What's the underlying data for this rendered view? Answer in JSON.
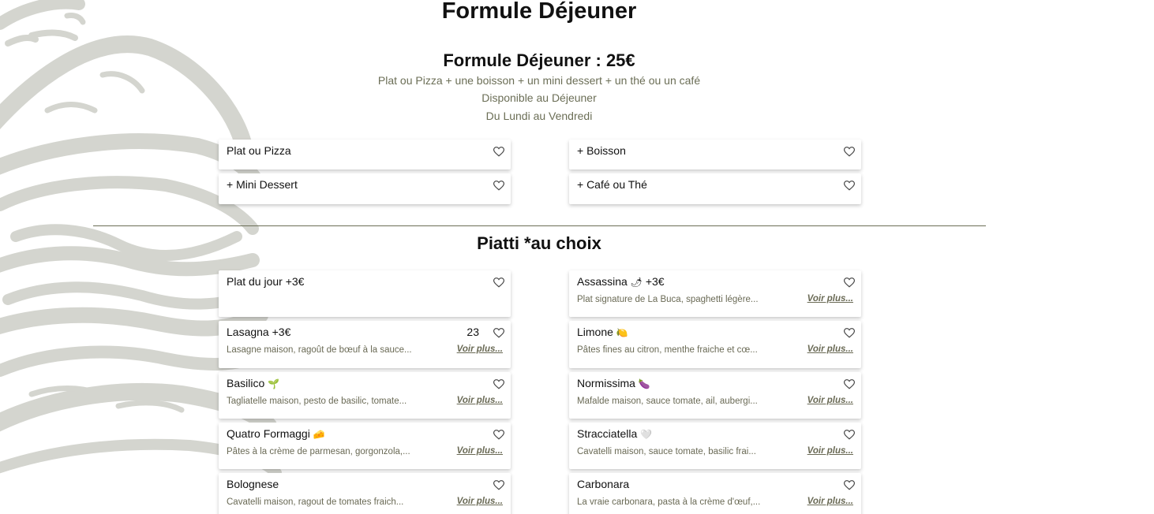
{
  "page": {
    "title": "Formule Déjeuner"
  },
  "formule": {
    "title": "Formule Déjeuner : 25€",
    "description": "Plat ou Pizza + une boisson + un mini dessert + un thé ou un café",
    "availability": "Disponible au Déjeuner",
    "days": "Du Lundi au Vendredi",
    "items": [
      {
        "name": "Plat ou Pizza"
      },
      {
        "name": "+ Boisson"
      },
      {
        "name": "+ Mini Dessert"
      },
      {
        "name": "+ Café ou Thé"
      }
    ]
  },
  "piatti": {
    "title": "Piatti *au choix",
    "more_label": "Voir plus...",
    "items": [
      {
        "name": "Plat du jour +3€",
        "emoji": "",
        "desc": ""
      },
      {
        "name": "Assassina",
        "emoji": "🌶",
        "suffix": " +3€",
        "desc": "Plat signature de La Buca, spaghetti légère..."
      },
      {
        "name": "Lasagna +3€",
        "emoji": "",
        "desc": "Lasagne maison, ragoût de bœuf à la sauce...",
        "count": "23"
      },
      {
        "name": "Limone",
        "emoji": "🍋",
        "desc": "Pâtes fines au citron, menthe fraiche et cœ..."
      },
      {
        "name": "Basilico",
        "emoji": "🌱",
        "desc": "Tagliatelle maison, pesto de basilic, tomate..."
      },
      {
        "name": "Normissima",
        "emoji": "🍆",
        "desc": "Mafalde maison, sauce tomate, ail, aubergi..."
      },
      {
        "name": "Quatro Formaggi",
        "emoji": "🧀",
        "desc": "Pâtes à la crème de parmesan, gorgonzola,..."
      },
      {
        "name": "Stracciatella",
        "emoji": "🤍",
        "desc": "Cavatelli maison, sauce tomate, basilic frai..."
      },
      {
        "name": "Bolognese",
        "emoji": "",
        "desc": "Cavatelli maison, ragout de tomates fraich..."
      },
      {
        "name": "Carbonara",
        "emoji": "",
        "desc": "La vraie carbonara, pasta à la crème d'œuf,..."
      }
    ]
  },
  "colors": {
    "accent_text": "#6b6e56",
    "illustration": "#d4d5cf"
  },
  "icons": {
    "favorite": "heart-outline-icon",
    "background": "burger-illustration"
  }
}
